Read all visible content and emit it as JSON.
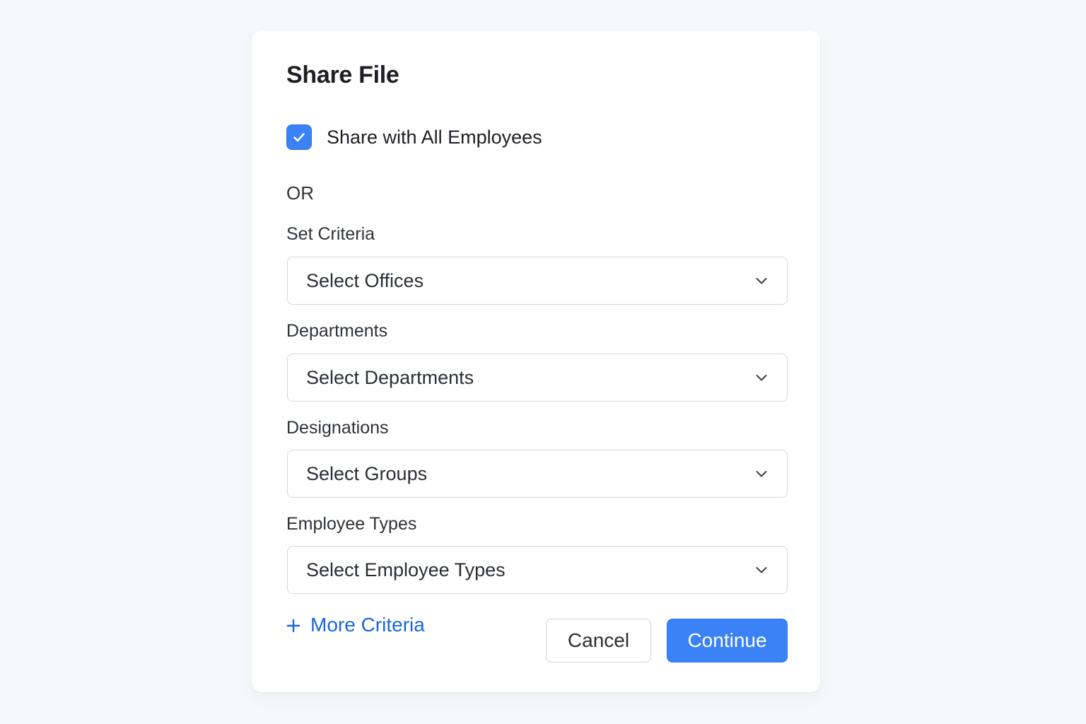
{
  "dialog": {
    "title": "Share File",
    "share_all": {
      "label": "Share with All Employees",
      "checked": true
    },
    "separator": "OR",
    "fields": [
      {
        "label": "Set Criteria",
        "placeholder": "Select Offices"
      },
      {
        "label": "Departments",
        "placeholder": "Select Departments"
      },
      {
        "label": "Designations",
        "placeholder": "Select Groups"
      },
      {
        "label": "Employee Types",
        "placeholder": "Select Employee Types"
      }
    ],
    "more_criteria": {
      "icon": "plus-icon",
      "label": "More Criteria"
    },
    "buttons": {
      "cancel": "Cancel",
      "continue": "Continue"
    }
  },
  "colors": {
    "accent": "#3b82f6",
    "link": "#1a66d9",
    "background": "#f7f8fa",
    "dialog": "#ffffff"
  }
}
